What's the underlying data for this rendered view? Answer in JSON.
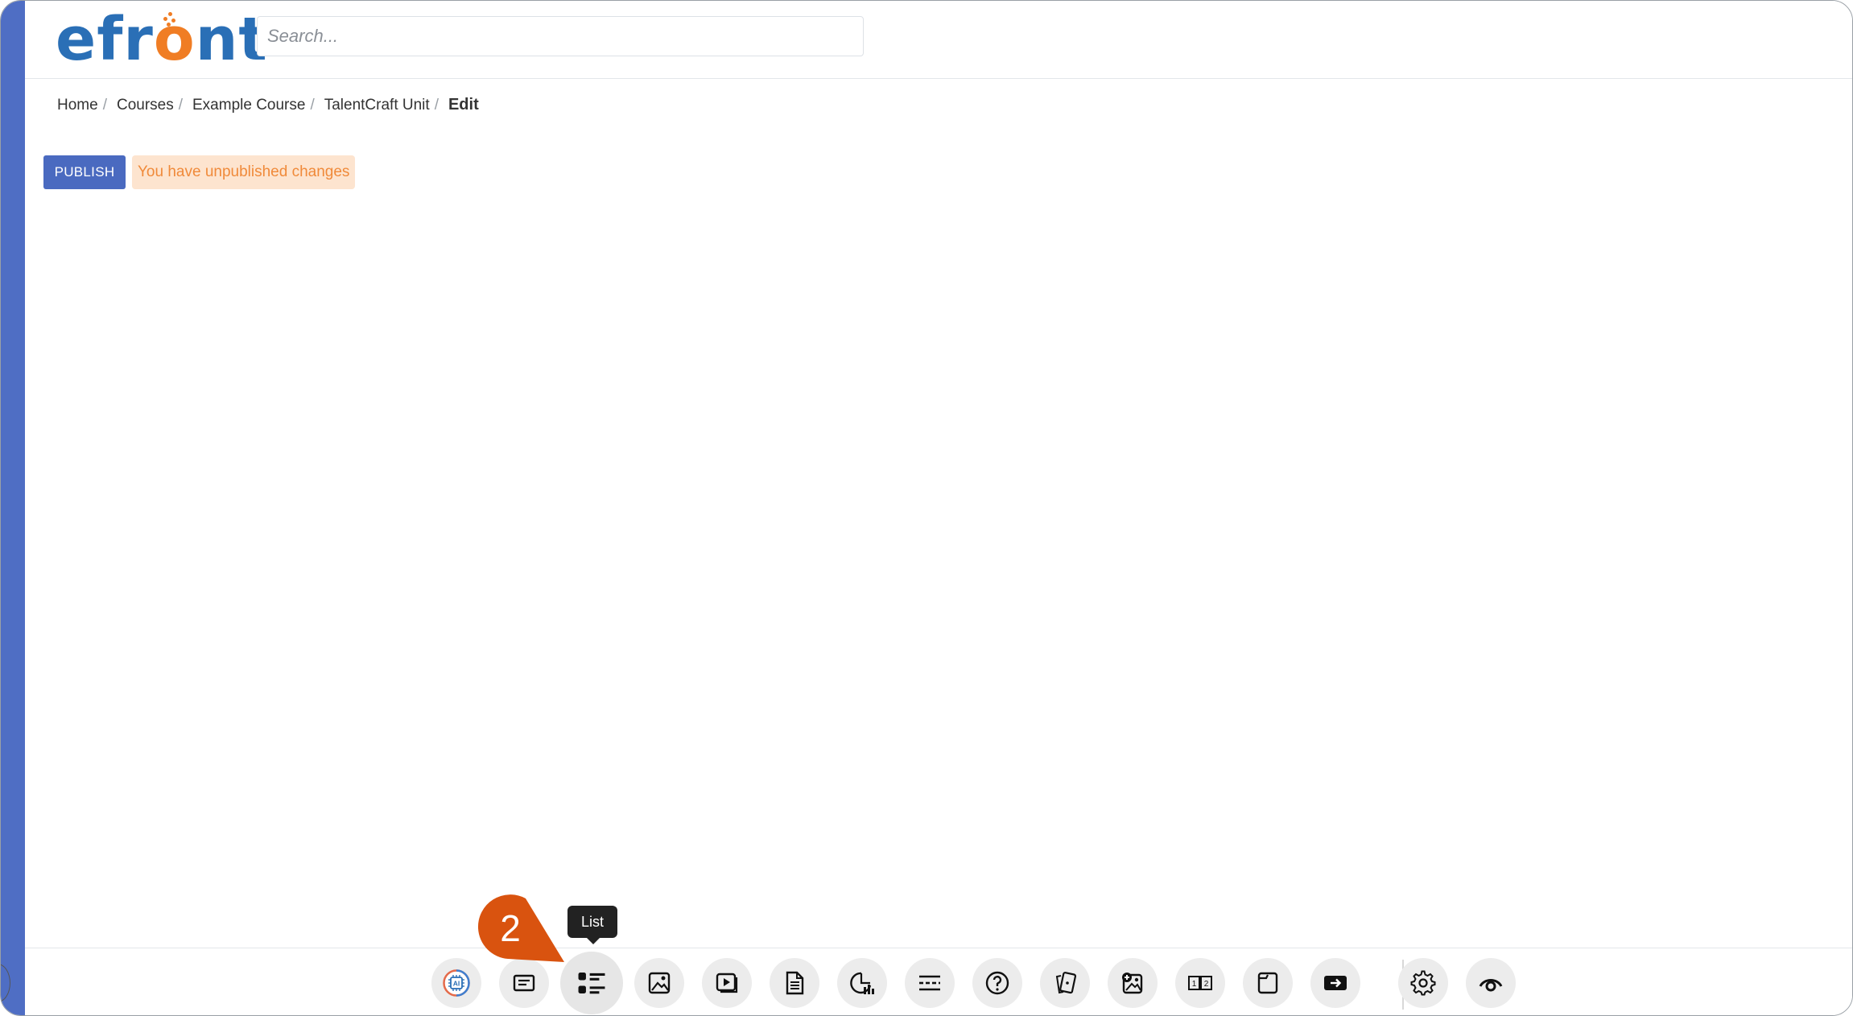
{
  "logo": {
    "part1": "efr",
    "part2": "o",
    "part3": "nt"
  },
  "search": {
    "placeholder": "Search...",
    "value": ""
  },
  "breadcrumb": {
    "items": [
      "Home",
      "Courses",
      "Example Course",
      "TalentCraft Unit"
    ],
    "separator": "/",
    "current": "Edit"
  },
  "actions": {
    "publish_label": "PUBLISH",
    "unpublished_label": "You have unpublished changes"
  },
  "toolbar": {
    "items": [
      {
        "name": "ai-icon",
        "label": "AI"
      },
      {
        "name": "text-icon",
        "label": "Text"
      },
      {
        "name": "list-icon",
        "label": "List"
      },
      {
        "name": "image-icon",
        "label": "Image"
      },
      {
        "name": "video-icon",
        "label": "Video"
      },
      {
        "name": "document-icon",
        "label": "Document"
      },
      {
        "name": "chart-icon",
        "label": "Chart"
      },
      {
        "name": "divider-icon",
        "label": "Divider"
      },
      {
        "name": "question-icon",
        "label": "Question"
      },
      {
        "name": "flashcards-icon",
        "label": "Flashcards"
      },
      {
        "name": "image-hotspot-icon",
        "label": "Image hotspot"
      },
      {
        "name": "steps-icon",
        "label": "Steps"
      },
      {
        "name": "page-icon",
        "label": "Page"
      },
      {
        "name": "embed-icon",
        "label": "Embed"
      },
      {
        "name": "gear-icon",
        "label": "Settings"
      },
      {
        "name": "eye-icon",
        "label": "Preview"
      }
    ],
    "tooltip": "List"
  },
  "tutorial": {
    "step_number": "2"
  },
  "colors": {
    "brand_blue": "#2a6fb6",
    "brand_orange": "#f07d24",
    "rail": "#4f6ec4",
    "publish": "#4a6ac0",
    "badge_bg": "#fde4cf",
    "badge_text": "#f08a3a",
    "step_marker": "#d9530f"
  }
}
